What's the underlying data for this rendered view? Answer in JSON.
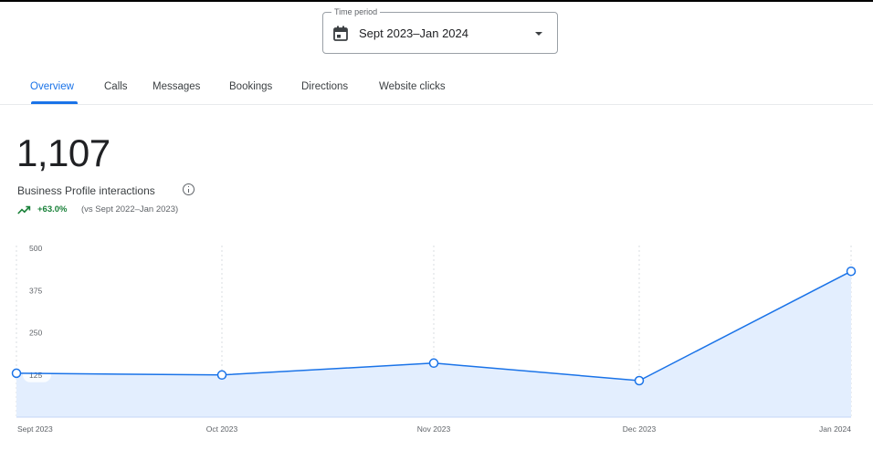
{
  "time_period": {
    "legend": "Time period",
    "value": "Sept 2023–Jan 2024",
    "icon": "calendar-icon"
  },
  "tabs": [
    {
      "label": "Overview",
      "active": true
    },
    {
      "label": "Calls",
      "active": false
    },
    {
      "label": "Messages",
      "active": false
    },
    {
      "label": "Bookings",
      "active": false
    },
    {
      "label": "Directions",
      "active": false
    },
    {
      "label": "Website clicks",
      "active": false
    }
  ],
  "metric": {
    "value": "1,107",
    "label": "Business Profile interactions",
    "change": "+63.0%",
    "comparison": "(vs Sept 2022–Jan 2023)",
    "trend_icon": "trending-up-icon"
  },
  "colors": {
    "accent": "#1a73e8",
    "positive": "#188038",
    "area_fill": "#e3eefe"
  },
  "chart_data": {
    "type": "area",
    "categories": [
      "Sept 2023",
      "Oct 2023",
      "Nov 2023",
      "Dec 2023",
      "Jan 2024"
    ],
    "values": [
      130,
      125,
      160,
      108,
      432
    ],
    "y_ticks": [
      125,
      250,
      375,
      500
    ],
    "ylim": [
      0,
      500
    ],
    "grid": "vertical dashed"
  }
}
